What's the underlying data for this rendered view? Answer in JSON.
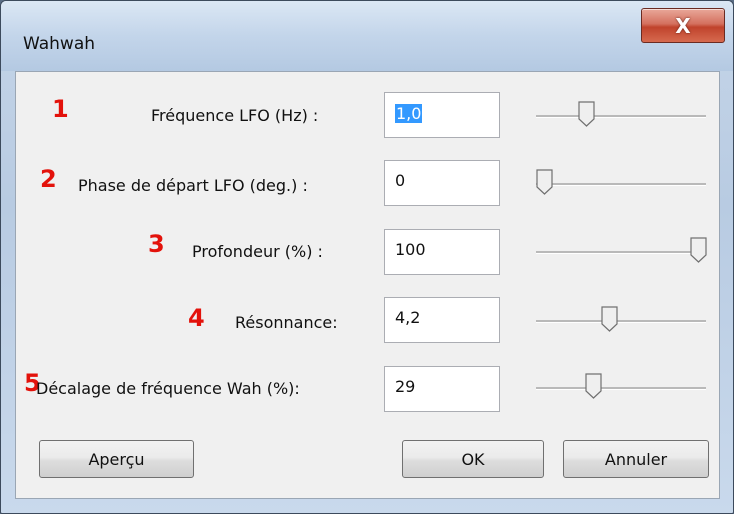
{
  "window": {
    "title": "Wahwah",
    "close_label": "X"
  },
  "rows": [
    {
      "number": "1",
      "label": "Fréquence LFO (Hz) :",
      "value": "1,0",
      "slider_fraction": 0.27
    },
    {
      "number": "2",
      "label": "Phase de départ LFO (deg.) :",
      "value": "0",
      "slider_fraction": 0.0
    },
    {
      "number": "3",
      "label": "Profondeur (%) :",
      "value": "100",
      "slider_fraction": 1.0
    },
    {
      "number": "4",
      "label": "Résonnance:",
      "value": "4,2",
      "slider_fraction": 0.42
    },
    {
      "number": "5",
      "label": "Décalage de fréquence Wah (%):",
      "value": "29",
      "slider_fraction": 0.32
    }
  ],
  "buttons": {
    "preview": "Aperçu",
    "ok": "OK",
    "cancel": "Annuler"
  },
  "colors": {
    "annotation_number": "#e3120b",
    "selection": "#3399ff"
  }
}
